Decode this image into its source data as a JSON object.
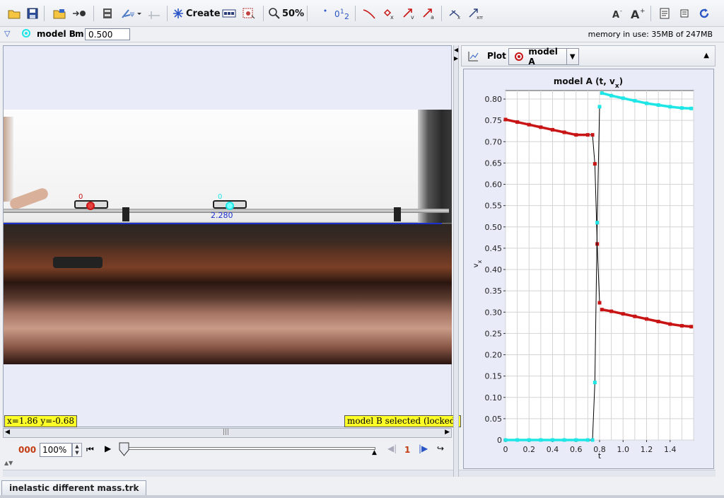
{
  "toolbar": {
    "create_label": "Create",
    "zoom_label": "50%"
  },
  "trackbar": {
    "track_name": "model B",
    "mass_label": "m",
    "mass_value": "0.500",
    "memory": "memory in use: 35MB of 247MB"
  },
  "video": {
    "marker_a_label": "0",
    "marker_b_label": "0",
    "position_label": "2.280",
    "coord_readout": "x=1.86  y=-0.68",
    "status_readout": "model B selected (locked)"
  },
  "player": {
    "frame_number": "000",
    "rate": "100%",
    "step_number": "1"
  },
  "plot_panel": {
    "plot_label": "Plot",
    "track_selector": "model A"
  },
  "file_tab": "inelastic different mass.trk",
  "colors": {
    "series_a": "#c81414",
    "series_b": "#1ee6e6",
    "fit_line": "#000000",
    "accent": "#ffff28"
  },
  "chart_data": {
    "type": "scatter",
    "title": "model A (t, vx)",
    "xlabel": "t",
    "ylabel": "vx",
    "xlim": [
      0,
      1.6
    ],
    "ylim": [
      0,
      0.82
    ],
    "xticks": [
      "0",
      "0.2",
      "0.4",
      "0.6",
      "0.8",
      "1.0",
      "1.2",
      "1.4"
    ],
    "yticks": [
      "0",
      "0.05",
      "0.10",
      "0.15",
      "0.20",
      "0.25",
      "0.30",
      "0.35",
      "0.40",
      "0.45",
      "0.50",
      "0.55",
      "0.60",
      "0.65",
      "0.70",
      "0.75",
      "0.80"
    ],
    "grid": true,
    "series": [
      {
        "color": "#c81414",
        "x": [
          0.0,
          0.1,
          0.2,
          0.3,
          0.4,
          0.5,
          0.6,
          0.7,
          0.74,
          0.76,
          0.78,
          0.8,
          0.82,
          0.9,
          1.0,
          1.1,
          1.2,
          1.3,
          1.4,
          1.5,
          1.58
        ],
        "y": [
          0.752,
          0.746,
          0.74,
          0.734,
          0.728,
          0.722,
          0.716,
          0.716,
          0.716,
          0.648,
          0.46,
          0.322,
          0.306,
          0.302,
          0.296,
          0.29,
          0.284,
          0.278,
          0.272,
          0.268,
          0.266
        ]
      },
      {
        "color": "#1ee6e6",
        "x": [
          0.0,
          0.1,
          0.2,
          0.3,
          0.4,
          0.5,
          0.6,
          0.7,
          0.74,
          0.76,
          0.78,
          0.8,
          0.82,
          0.9,
          1.0,
          1.1,
          1.2,
          1.3,
          1.4,
          1.5,
          1.58
        ],
        "y": [
          0.0,
          0.0,
          0.0,
          0.0,
          0.0,
          0.0,
          0.0,
          0.0,
          0.0,
          0.135,
          0.51,
          0.782,
          0.814,
          0.808,
          0.802,
          0.796,
          0.79,
          0.786,
          0.782,
          0.779,
          0.778
        ]
      }
    ]
  }
}
